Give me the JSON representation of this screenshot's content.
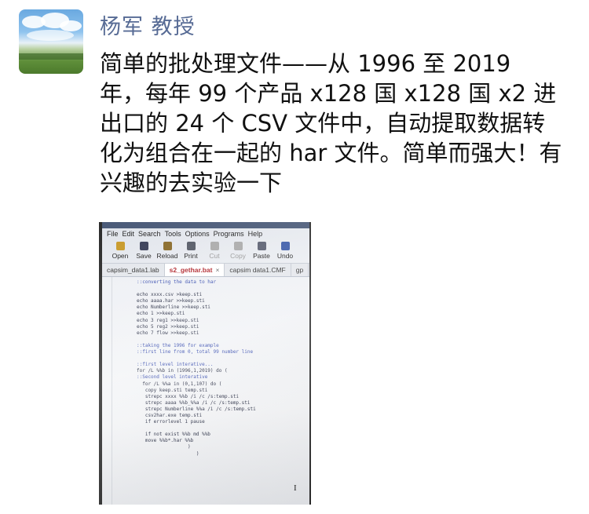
{
  "post": {
    "author": "杨军 教授",
    "text": "简单的批处理文件——从 1996 至 2019 年，每年 99 个产品 x128 国 x128 国 x2 进出口的 24 个 CSV 文件中，自动提取数据转化为组合在一起的 har 文件。简单而强大！有兴趣的去实验一下"
  },
  "screenshot_photo": {
    "menu": [
      "File",
      "Edit",
      "Search",
      "Tools",
      "Options",
      "Programs",
      "Help"
    ],
    "toolbar": [
      {
        "label": "Open",
        "icon": "folder-open-icon",
        "color": "#c89a2a",
        "enabled": true
      },
      {
        "label": "Save",
        "icon": "floppy-disk-icon",
        "color": "#3a3f58",
        "enabled": true
      },
      {
        "label": "Reload",
        "icon": "reload-icon",
        "color": "#8a6b2a",
        "enabled": true
      },
      {
        "label": "Print",
        "icon": "printer-icon",
        "color": "#555a66",
        "enabled": true
      },
      {
        "label": "Cut",
        "icon": "scissors-icon",
        "color": "#aaaaaa",
        "enabled": false
      },
      {
        "label": "Copy",
        "icon": "copy-icon",
        "color": "#aaaaaa",
        "enabled": false
      },
      {
        "label": "Paste",
        "icon": "clipboard-icon",
        "color": "#5a5f70",
        "enabled": true
      },
      {
        "label": "Undo",
        "icon": "undo-icon",
        "color": "#3a5aa8",
        "enabled": true
      }
    ],
    "tabs": [
      {
        "label": "capsim_data1.lab",
        "active": false
      },
      {
        "label": "s2_gethar.bat",
        "active": true,
        "close": "×"
      },
      {
        "label": "capsim data1.CMF",
        "active": false
      },
      {
        "label": "gp",
        "active": false
      }
    ],
    "code_lines": [
      {
        "text": "::converting the data to har",
        "comment": true
      },
      {
        "text": "",
        "comment": false
      },
      {
        "text": "echo xxxx.csv >keep.sti",
        "comment": false
      },
      {
        "text": "echo aaaa.har >>keep.sti",
        "comment": false
      },
      {
        "text": "echo Numberline >>keep.sti",
        "comment": false
      },
      {
        "text": "echo 1 >>keep.sti",
        "comment": false
      },
      {
        "text": "echo 3 reg1 >>keep.sti",
        "comment": false
      },
      {
        "text": "echo 5 reg2 >>keep.sti",
        "comment": false
      },
      {
        "text": "echo 7 flow >>keep.sti",
        "comment": false
      },
      {
        "text": "",
        "comment": false
      },
      {
        "text": "::taking the 1996 for example",
        "comment": true
      },
      {
        "text": "::first line from 0, total 99 number line",
        "comment": true
      },
      {
        "text": "",
        "comment": false
      },
      {
        "text": "::first level interative...",
        "comment": true
      },
      {
        "text": "for /L %%b in (1996,1,2019) do (",
        "comment": false
      },
      {
        "text": "::Second level interative",
        "comment": true
      },
      {
        "text": "  for /L %%a in (0,1,107) do (",
        "comment": false
      },
      {
        "text": "   copy keep.sti temp.sti",
        "comment": false
      },
      {
        "text": "   strepc xxxx %%b /i /c /s:temp.sti",
        "comment": false
      },
      {
        "text": "   strepc aaaa %%b_%%a /i /c /s:temp.sti",
        "comment": false
      },
      {
        "text": "   strepc Numberline %%a /i /c /s:temp.sti",
        "comment": false
      },
      {
        "text": "   csv2har.exe temp.sti",
        "comment": false
      },
      {
        "text": "   if errorlevel 1 pause",
        "comment": false
      },
      {
        "text": "",
        "comment": false
      },
      {
        "text": "   if not exist %%b md %%b",
        "comment": false
      },
      {
        "text": "   move %%b*.har %%b",
        "comment": false
      },
      {
        "text": "                  )",
        "comment": false
      },
      {
        "text": "                     )",
        "comment": false
      }
    ]
  }
}
